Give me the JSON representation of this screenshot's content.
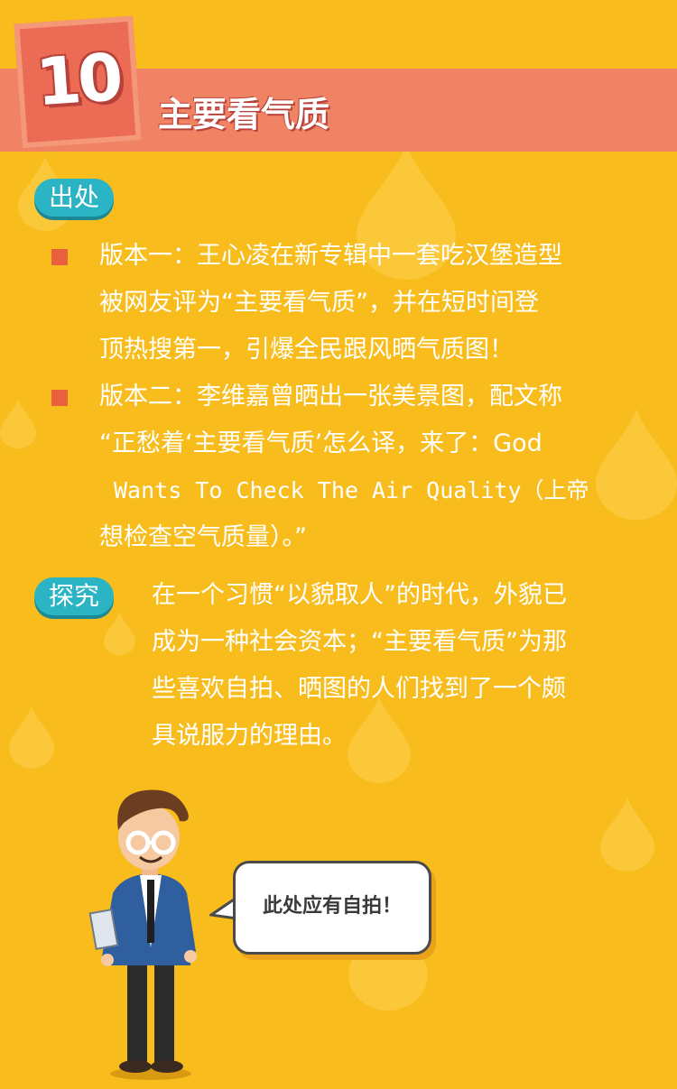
{
  "header": {
    "number": "10",
    "title": "主要看气质"
  },
  "source_section": {
    "label": "出处",
    "items": [
      {
        "lines": [
          "版本一：王心凌在新专辑中一套吃汉堡造型",
          "被网友评为“主要看气质”，并在短时间登",
          "顶热搜第一，引爆全民跟风晒气质图！"
        ]
      },
      {
        "lines": [
          "版本二：李维嘉曾晒出一张美景图，配文称",
          "“正愁着‘主要看气质’怎么译，来了：God",
          "Wants To Check The Air Quality（上帝",
          "想检查空气质量）。”"
        ]
      }
    ]
  },
  "explore_section": {
    "label": "探究",
    "lines": [
      "在一个习惯“以貌取人”的时代，外貌已",
      "成为一种社会资本；“主要看气质”为那",
      "些喜欢自拍、晒图的人们找到了一个颇",
      "具说服力的理由。"
    ]
  },
  "speech_bubble": {
    "text": "此处应有自拍！"
  },
  "colors": {
    "background": "#f8bd1d",
    "header_band": "#ef8363",
    "pill": "#2ab4c4",
    "bullet": "#e8603e",
    "text": "#ffffff"
  },
  "icons": [
    "water-drop-icon",
    "cartoon-man-illustration",
    "speech-bubble-icon"
  ]
}
